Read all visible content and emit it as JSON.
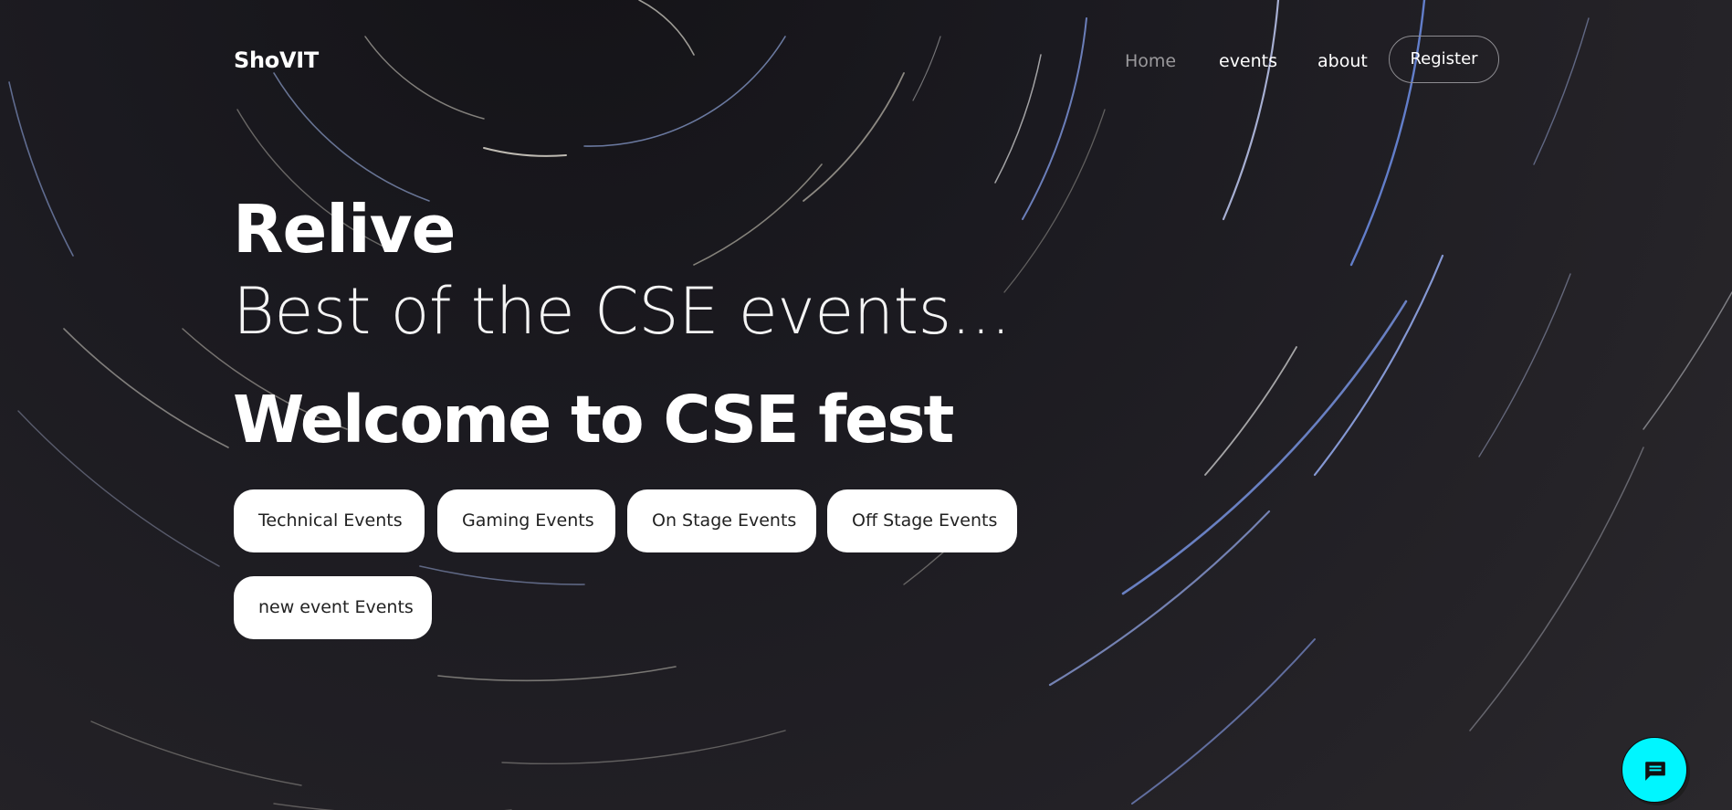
{
  "nav": {
    "brand": "ShoVIT",
    "links": [
      {
        "label": "Home",
        "active": true
      },
      {
        "label": "events"
      },
      {
        "label": "about"
      }
    ],
    "register_label": "Register"
  },
  "hero": {
    "line1": "Relive",
    "line2": "Best of the CSE events...",
    "line3": "Welcome to CSE fest"
  },
  "event_buttons": [
    "Technical Events",
    "Gaming Events",
    "On Stage Events",
    "Off Stage Events",
    "new event Events"
  ],
  "chat": {
    "icon": "chat-icon",
    "color": "#00f6ff"
  },
  "colors": {
    "background": "#1a191e",
    "text": "#ffffff",
    "nav_inactive": "#9a999c",
    "button_bg": "#ffffff",
    "button_text": "#222222"
  }
}
